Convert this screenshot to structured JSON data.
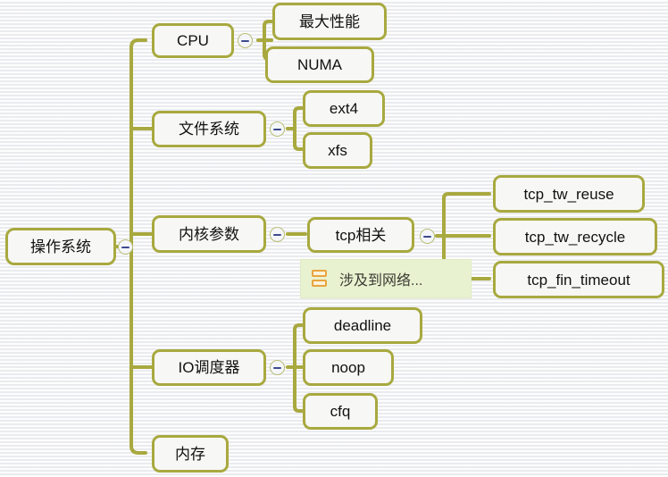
{
  "app": {
    "type": "mindmap",
    "background_color": "#f2f3f5",
    "node_border_color": "#a8a93f",
    "node_fill_color": "#f7f7f5",
    "connector_color": "#a8a93f",
    "note_background_color": "#e9f2d0",
    "note_icon_color": "#e8a33d"
  },
  "root": {
    "label": "操作系统"
  },
  "branches": [
    {
      "label": "CPU",
      "children": [
        {
          "label": "最大性能"
        },
        {
          "label": "NUMA"
        }
      ]
    },
    {
      "label": "文件系统",
      "children": [
        {
          "label": "ext4"
        },
        {
          "label": "xfs"
        }
      ]
    },
    {
      "label": "内核参数",
      "children": [
        {
          "label": "tcp相关",
          "children": [
            {
              "label": "tcp_tw_reuse"
            },
            {
              "label": "tcp_tw_recycle"
            },
            {
              "label": "tcp_fin_timeout"
            }
          ]
        }
      ]
    },
    {
      "label": "IO调度器",
      "children": [
        {
          "label": "deadline"
        },
        {
          "label": "noop"
        },
        {
          "label": "cfq"
        }
      ]
    },
    {
      "label": "内存",
      "children": []
    }
  ],
  "note": {
    "text": "涉及到网络...",
    "icon": "note-icon"
  },
  "toggles": {
    "symbol": "−",
    "state": "expanded"
  }
}
